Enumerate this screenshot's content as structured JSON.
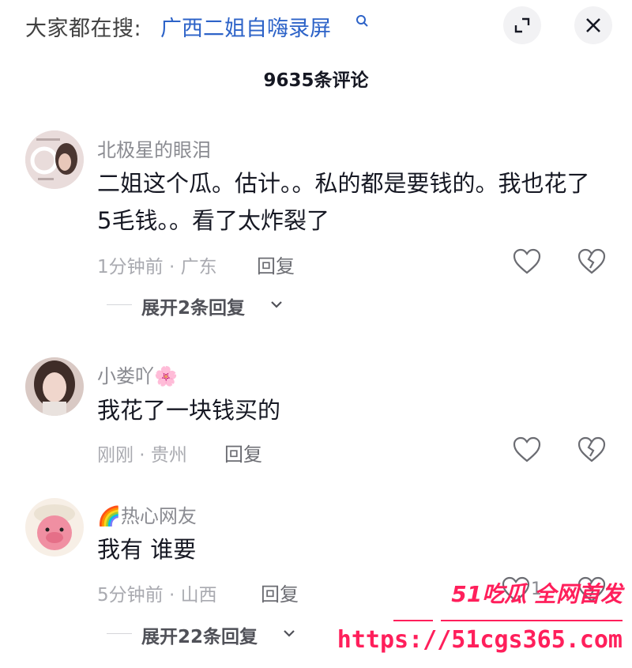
{
  "top_bar": {
    "search_prefix": "大家都在搜:",
    "search_term": "广西二姐自嗨录屏",
    "expand_icon": "expand-icon",
    "close_icon": "close-icon"
  },
  "comment_count": "9635条评论",
  "comments": [
    {
      "username": "北极星的眼泪",
      "text": "二姐这个瓜。估计。。私的都是要钱的。我也花了5毛钱。。看了太炸裂了",
      "meta": "1分钟前 · 广东",
      "reply_label": "回复",
      "like_count": "",
      "expand_label": "展开2条回复"
    },
    {
      "username": "小娄吖🌸",
      "text": "我花了一块钱买的",
      "meta": "刚刚 · 贵州",
      "reply_label": "回复",
      "like_count": ""
    },
    {
      "username": "🌈热心网友",
      "text": "我有 谁要",
      "meta": "5分钟前 · 山西",
      "reply_label": "回复",
      "like_count": "1",
      "expand_label": "展开22条回复"
    }
  ],
  "watermark": {
    "title": "51吃瓜 全网首发",
    "url": "https://51cgs365.com"
  },
  "colors": {
    "link_blue": "#2d63c8",
    "watermark_red": "#ff1f5b",
    "meta_gray": "#a9aab0"
  }
}
